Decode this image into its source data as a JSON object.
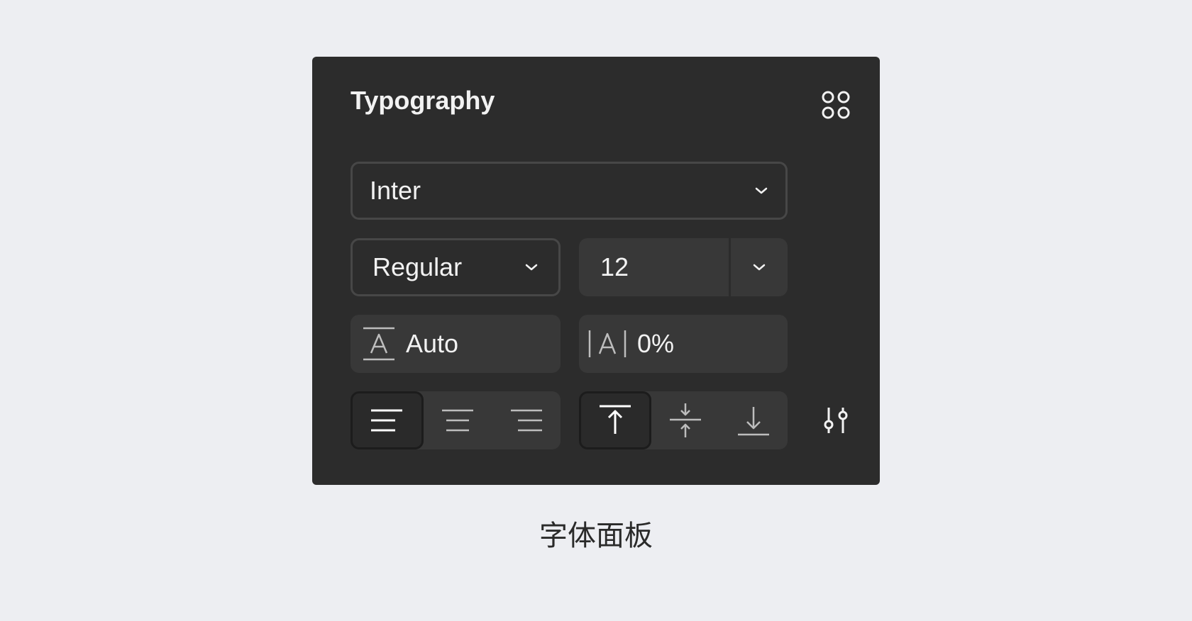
{
  "panel": {
    "title": "Typography",
    "font_family": {
      "value": "Inter"
    },
    "font_weight": {
      "value": "Regular"
    },
    "font_size": {
      "value": "12"
    },
    "line_height": {
      "value": "Auto",
      "icon": "line-height-icon"
    },
    "letter_spacing": {
      "value": "0%",
      "icon": "letter-spacing-icon"
    },
    "text_align": {
      "options": [
        "left",
        "center",
        "right"
      ],
      "selected": "left"
    },
    "vertical_align": {
      "options": [
        "top",
        "middle",
        "bottom"
      ],
      "selected": "top"
    },
    "icons": {
      "styles": "styles-grid-icon",
      "advanced": "sliders-icon",
      "dropdown": "chevron-down-icon"
    },
    "colors": {
      "panel_bg": "#2c2c2c",
      "field_bg": "#383838",
      "border": "#474747",
      "text": "#f2f2f2",
      "page_bg": "#edeef2"
    }
  },
  "caption": "字体面板"
}
